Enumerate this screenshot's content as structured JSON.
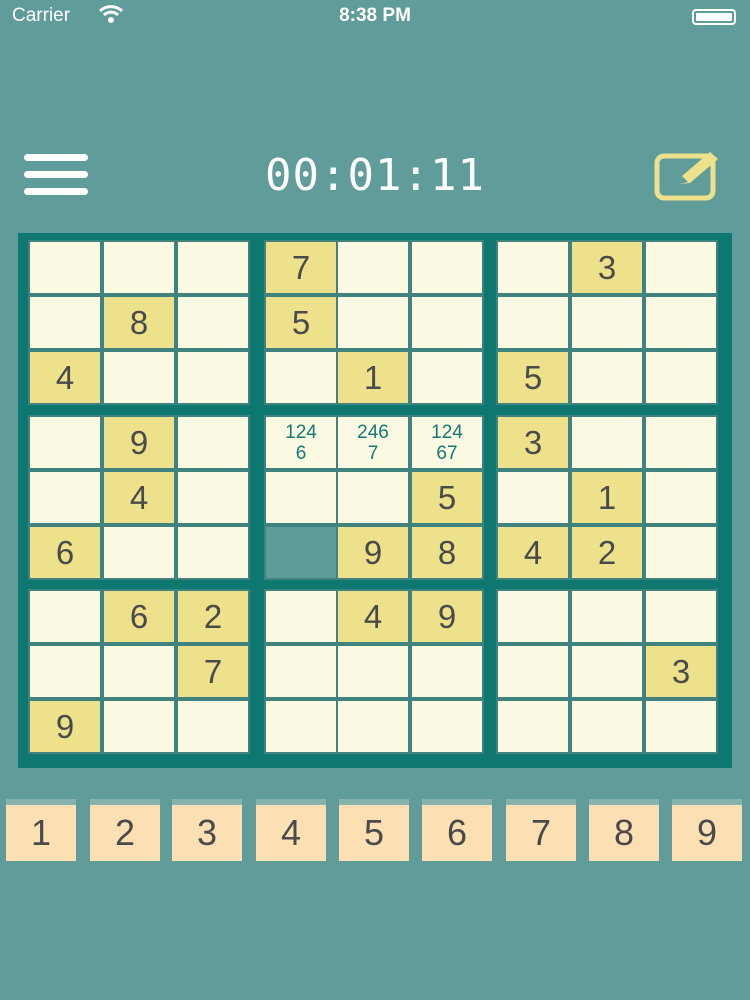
{
  "status_bar": {
    "carrier": "Carrier",
    "time": "8:38 PM"
  },
  "header": {
    "timer": "00:01:11",
    "menu_icon": "hamburger-menu-icon",
    "edit_icon": "pencil-edit-icon"
  },
  "colors": {
    "background": "#5f9c9a",
    "board_frame": "#0e7770",
    "given_cell": "#eee18c",
    "empty_cell": "#fcfae2",
    "key": "#fce0b3",
    "notes_text": "#137a74"
  },
  "board": {
    "cells": [
      [
        "",
        "",
        "",
        "7",
        "",
        "",
        "",
        "3",
        ""
      ],
      [
        "",
        "8",
        "",
        "5",
        "",
        "",
        "",
        "",
        ""
      ],
      [
        "4",
        "",
        "",
        "",
        "1",
        "",
        "5",
        "",
        ""
      ],
      [
        "",
        "9",
        "",
        "124\n6",
        "246\n7",
        "124\n67",
        "3",
        "",
        ""
      ],
      [
        "",
        "4",
        "",
        "",
        "",
        "5",
        "",
        "1",
        ""
      ],
      [
        "6",
        "",
        "",
        "",
        "9",
        "8",
        "4",
        "2",
        ""
      ],
      [
        "",
        "6",
        "2",
        "",
        "4",
        "9",
        "",
        "",
        ""
      ],
      [
        "",
        "",
        "7",
        "",
        "",
        "",
        "",
        "",
        "3"
      ],
      [
        "9",
        "",
        "",
        "",
        "",
        "",
        "",
        "",
        ""
      ]
    ],
    "notes_cells": [
      [
        3,
        3
      ],
      [
        3,
        4
      ],
      [
        3,
        5
      ]
    ],
    "selected_cell": [
      5,
      3
    ]
  },
  "keypad": {
    "keys": [
      "1",
      "2",
      "3",
      "4",
      "5",
      "6",
      "7",
      "8",
      "9"
    ]
  }
}
